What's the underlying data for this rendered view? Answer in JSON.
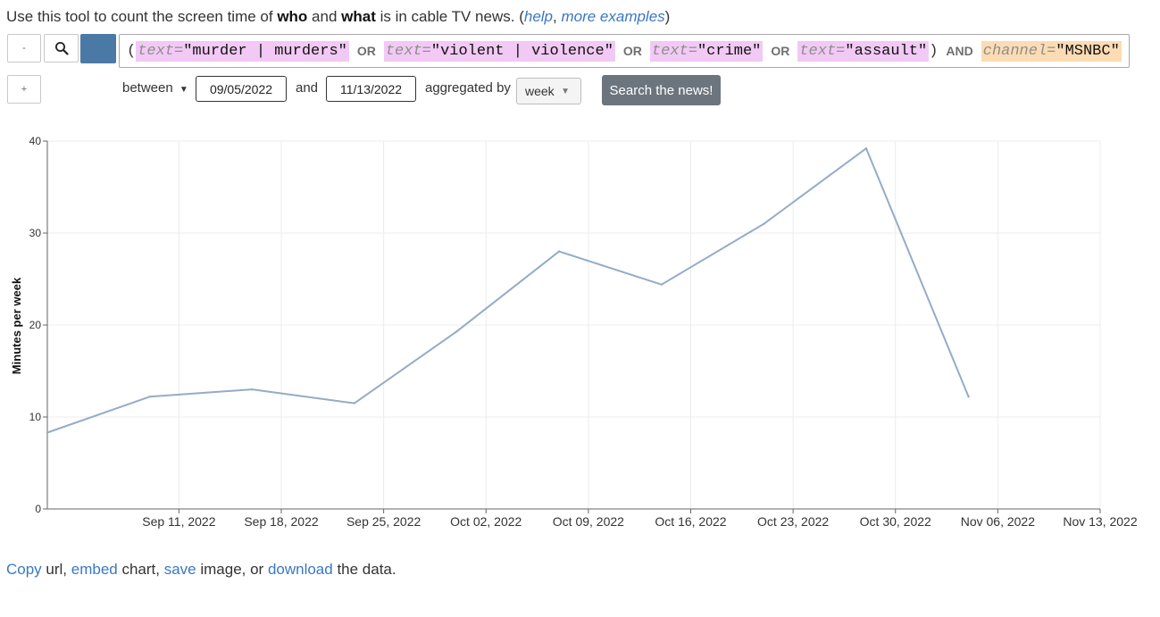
{
  "intro": {
    "text_1": "Use this tool to count the screen time of ",
    "who": "who",
    "and": " and ",
    "what": "what",
    "text_2": " is in cable TV news. (",
    "help_link": "help",
    "comma": ", ",
    "examples_link": "more examples",
    "close": ")"
  },
  "controls": {
    "remove_label": "-",
    "add_label": "+",
    "search_icon": "magnifier-icon",
    "line_color": "#4b79a6"
  },
  "query": {
    "open_paren": "(",
    "close_paren": ")",
    "terms": [
      {
        "key": "text=",
        "value": "\"murder | murders\""
      },
      {
        "key": "text=",
        "value": "\"violent | violence\""
      },
      {
        "key": "text=",
        "value": "\"crime\""
      },
      {
        "key": "text=",
        "value": "\"assault\""
      }
    ],
    "or_label": "OR",
    "and_label": "AND",
    "channel": {
      "key": "channel=",
      "value": "\"MSNBC\""
    }
  },
  "range": {
    "between_label": "between",
    "start_date": "09/05/2022",
    "and_label": "and",
    "end_date": "11/13/2022",
    "aggregated_label": "aggregated by",
    "aggregation": "week",
    "search_button": "Search the news!"
  },
  "chart_data": {
    "type": "line",
    "title": "",
    "xlabel": "",
    "ylabel": "Minutes per week",
    "ylim": [
      0,
      40
    ],
    "yticks": [
      0,
      10,
      20,
      30,
      40
    ],
    "xlim": [
      "2022-09-02",
      "2022-11-13"
    ],
    "x_tick_labels": [
      "Sep 11, 2022",
      "Sep 18, 2022",
      "Sep 25, 2022",
      "Oct 02, 2022",
      "Oct 09, 2022",
      "Oct 16, 2022",
      "Oct 23, 2022",
      "Oct 30, 2022",
      "Nov 06, 2022",
      "Nov 13, 2022"
    ],
    "x_tick_dates": [
      "2022-09-11",
      "2022-09-18",
      "2022-09-25",
      "2022-10-02",
      "2022-10-09",
      "2022-10-16",
      "2022-10-23",
      "2022-10-30",
      "2022-11-06",
      "2022-11-13"
    ],
    "grid": true,
    "series": [
      {
        "color": "#94acc6",
        "x": [
          "2022-09-02",
          "2022-09-09",
          "2022-09-16",
          "2022-09-23",
          "2022-09-30",
          "2022-10-07",
          "2022-10-14",
          "2022-10-21",
          "2022-10-28",
          "2022-11-04"
        ],
        "values": [
          8.3,
          12.2,
          13.0,
          11.5,
          19.3,
          28.0,
          24.4,
          31.0,
          39.2,
          12.2
        ]
      }
    ]
  },
  "footer": {
    "copy_link": "Copy",
    "t1": " url, ",
    "embed_link": "embed",
    "t2": " chart, ",
    "save_link": "save",
    "t3": " image, or ",
    "download_link": "download",
    "t4": " the data."
  }
}
